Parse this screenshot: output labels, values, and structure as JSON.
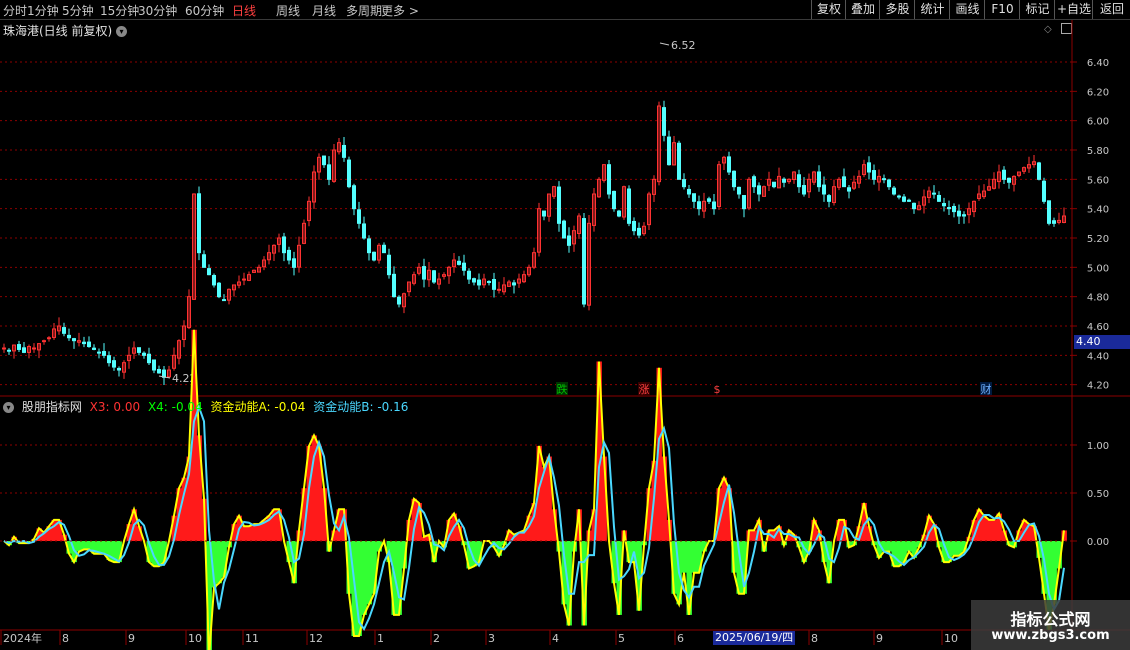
{
  "toolbar": {
    "periods": [
      "分时",
      "1分钟",
      "5分钟",
      "15分钟",
      "30分钟",
      "60分钟",
      "日线",
      "周线",
      "月线",
      "多周期",
      "更多"
    ],
    "active_period": "日线",
    "buttons": [
      "复权",
      "叠加",
      "多股",
      "统计",
      "画线",
      "F10",
      "标记",
      "+自选",
      "返回"
    ]
  },
  "main_chart": {
    "title": "珠海港(日线 前复权)",
    "high_label": "6.52",
    "low_label": "4.22",
    "current_price": "4.40",
    "price_ticks": [
      "6.40",
      "6.20",
      "6.00",
      "5.80",
      "5.60",
      "5.40",
      "5.20",
      "5.00",
      "4.80",
      "4.60",
      "4.40",
      "4.20"
    ],
    "markers": [
      {
        "text": "跌",
        "color": "#00c000",
        "bg": "#003300"
      },
      {
        "text": "涨",
        "color": "#ff4040",
        "bg": "#330000"
      },
      {
        "text": "$",
        "color": "#ff4040",
        "bg": "#000"
      },
      {
        "text": "财",
        "color": "#6fb0ff",
        "bg": "#001a40"
      }
    ]
  },
  "indicator": {
    "name": "股朋指标网",
    "x3_label": "X3: 0.00",
    "x4_label": "X4: -0.04",
    "a_label": "资金动能A: -0.04",
    "b_label": "资金动能B: -0.16",
    "ticks": [
      "1.00",
      "0.50",
      "0.00"
    ]
  },
  "time_axis": {
    "labels": [
      "2024年",
      "8",
      "9",
      "10",
      "11",
      "12",
      "1",
      "2",
      "3",
      "4",
      "5",
      "6",
      "8",
      "9",
      "10"
    ],
    "cursor_date": "2025/06/19/四"
  },
  "watermark": {
    "line1": "指标公式网",
    "line2": "www.zbgs3.com"
  },
  "colors": {
    "up": "#ff3232",
    "down": "#54ffff",
    "green": "#00ff00",
    "yellow": "#ffff00",
    "cyan": "#4ad8ff",
    "grid": "#8b0000"
  },
  "chart_data": {
    "type": "candlestick",
    "ylim": [
      4.15,
      6.55
    ],
    "closes": [
      4.45,
      4.43,
      4.47,
      4.44,
      4.42,
      4.46,
      4.45,
      4.48,
      4.5,
      4.52,
      4.58,
      4.6,
      4.55,
      4.52,
      4.5,
      4.5,
      4.48,
      4.46,
      4.44,
      4.42,
      4.4,
      4.35,
      4.32,
      4.3,
      4.35,
      4.4,
      4.45,
      4.42,
      4.4,
      4.35,
      4.3,
      4.28,
      4.25,
      4.3,
      4.4,
      4.5,
      4.6,
      4.8,
      5.5,
      5.1,
      5.0,
      4.95,
      4.88,
      4.8,
      4.78,
      4.85,
      4.88,
      4.9,
      4.92,
      4.95,
      4.98,
      5.0,
      5.05,
      5.1,
      5.15,
      5.2,
      5.1,
      5.05,
      5.0,
      5.15,
      5.3,
      5.45,
      5.65,
      5.75,
      5.7,
      5.6,
      5.8,
      5.85,
      5.75,
      5.55,
      5.4,
      5.3,
      5.2,
      5.1,
      5.05,
      5.15,
      5.1,
      4.95,
      4.8,
      4.75,
      4.82,
      4.9,
      4.95,
      5.0,
      4.92,
      4.98,
      4.9,
      4.92,
      4.95,
      5.0,
      5.05,
      5.02,
      4.98,
      4.92,
      4.9,
      4.88,
      4.92,
      4.9,
      4.85,
      4.85,
      4.88,
      4.9,
      4.88,
      4.92,
      4.95,
      5.0,
      5.1,
      5.4,
      5.35,
      5.5,
      5.55,
      5.3,
      5.2,
      5.15,
      5.25,
      5.35,
      4.75,
      5.3,
      5.5,
      5.6,
      5.7,
      5.5,
      5.4,
      5.35,
      5.55,
      5.3,
      5.25,
      5.22,
      5.28,
      5.5,
      5.6,
      6.1,
      5.9,
      5.7,
      5.85,
      5.6,
      5.55,
      5.5,
      5.45,
      5.4,
      5.45,
      5.45,
      5.4,
      5.7,
      5.75,
      5.65,
      5.55,
      5.5,
      5.4,
      5.6,
      5.55,
      5.5,
      5.55,
      5.6,
      5.55,
      5.62,
      5.58,
      5.6,
      5.65,
      5.55,
      5.5,
      5.6,
      5.65,
      5.55,
      5.5,
      5.45,
      5.55,
      5.6,
      5.55,
      5.52,
      5.58,
      5.62,
      5.7,
      5.65,
      5.6,
      5.62,
      5.6,
      5.55,
      5.5,
      5.48,
      5.45,
      5.45,
      5.4,
      5.42,
      5.48,
      5.52,
      5.5,
      5.45,
      5.42,
      5.4,
      5.38,
      5.35,
      5.35,
      5.4,
      5.45,
      5.5,
      5.52,
      5.55,
      5.6,
      5.65,
      5.6,
      5.58,
      5.62,
      5.65,
      5.68,
      5.7,
      5.72,
      5.6,
      5.45,
      5.3,
      5.3,
      5.32,
      5.35
    ]
  }
}
